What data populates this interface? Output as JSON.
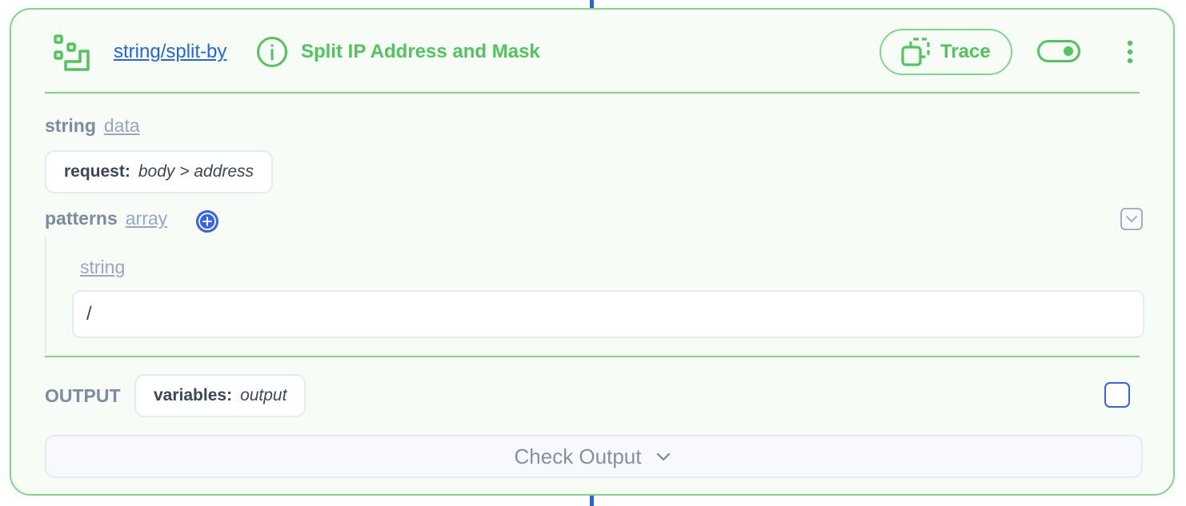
{
  "node": {
    "function_link": "string/split-by",
    "title": "Split IP Address and Mask",
    "trace_label": "Trace",
    "enabled": true
  },
  "params": {
    "string": {
      "label": "string",
      "type": "data",
      "chip_key": "request:",
      "chip_value": "body > address"
    },
    "patterns": {
      "label": "patterns",
      "type": "array",
      "item_type": "string",
      "item_value": "/"
    }
  },
  "output": {
    "label": "OUTPUT",
    "chip_key": "variables:",
    "chip_value": "output",
    "checked": false
  },
  "check_output": {
    "label": "Check Output"
  },
  "colors": {
    "accent_green": "#52c45f",
    "border_green": "#7ed78a",
    "link_blue": "#2563eb",
    "card_bg": "#f7fdf6"
  },
  "icons": {
    "node": "flow-steps-icon",
    "info": "info-circle-icon",
    "trace": "copy-dashed-icon",
    "menu": "vertical-dots-icon",
    "add": "plus-circle-icon",
    "collapse": "chevron-down-square-icon",
    "expand": "chevron-down-icon"
  }
}
